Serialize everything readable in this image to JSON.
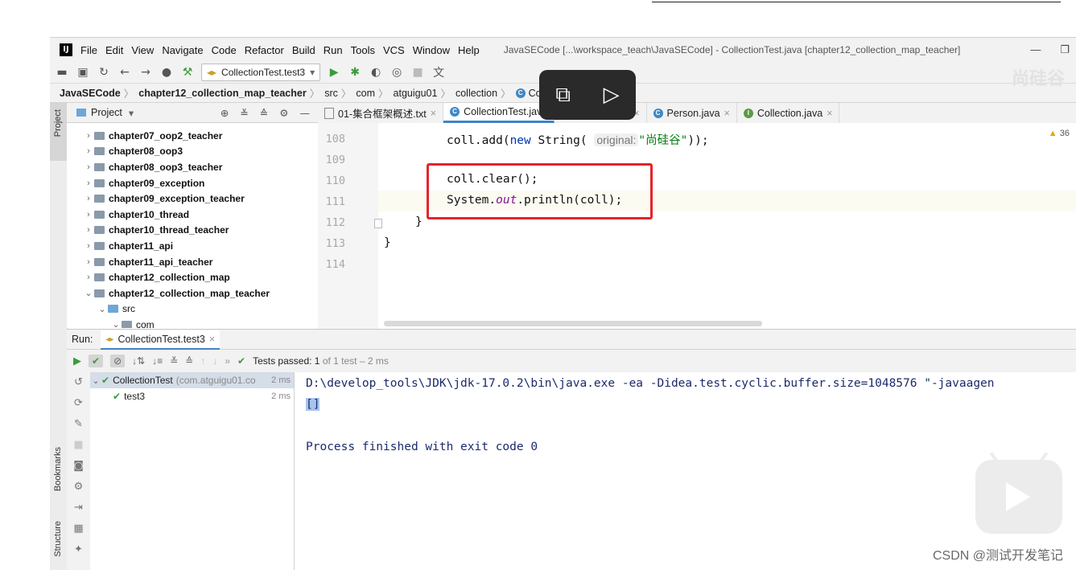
{
  "menubar": {
    "logo": "IJ",
    "items": [
      "File",
      "Edit",
      "View",
      "Navigate",
      "Code",
      "Refactor",
      "Build",
      "Run",
      "Tools",
      "VCS",
      "Window",
      "Help"
    ],
    "window_title": "JavaSECode [...\\workspace_teach\\JavaSECode] - CollectionTest.java [chapter12_collection_map_teacher]",
    "minimize": "—",
    "maximize": "❐"
  },
  "toolbar": {
    "run_config": "CollectionTest.test3"
  },
  "breadcrumb": [
    "JavaSECode",
    "chapter12_collection_map_teacher",
    "src",
    "com",
    "atguigu01",
    "collection",
    "CollectionT"
  ],
  "project_panel": {
    "title": "Project",
    "stripe_label": "Project",
    "items": [
      {
        "label": "chapter07_oop2_teacher",
        "indent": 1,
        "expanded": false,
        "type": "module"
      },
      {
        "label": "chapter08_oop3",
        "indent": 1,
        "expanded": false,
        "type": "module"
      },
      {
        "label": "chapter08_oop3_teacher",
        "indent": 1,
        "expanded": false,
        "type": "module"
      },
      {
        "label": "chapter09_exception",
        "indent": 1,
        "expanded": false,
        "type": "module"
      },
      {
        "label": "chapter09_exception_teacher",
        "indent": 1,
        "expanded": false,
        "type": "module"
      },
      {
        "label": "chapter10_thread",
        "indent": 1,
        "expanded": false,
        "type": "module"
      },
      {
        "label": "chapter10_thread_teacher",
        "indent": 1,
        "expanded": false,
        "type": "module"
      },
      {
        "label": "chapter11_api",
        "indent": 1,
        "expanded": false,
        "type": "module"
      },
      {
        "label": "chapter11_api_teacher",
        "indent": 1,
        "expanded": false,
        "type": "module"
      },
      {
        "label": "chapter12_collection_map",
        "indent": 1,
        "expanded": false,
        "type": "module"
      },
      {
        "label": "chapter12_collection_map_teacher",
        "indent": 1,
        "expanded": true,
        "type": "module"
      },
      {
        "label": "src",
        "indent": 2,
        "expanded": true,
        "type": "source"
      },
      {
        "label": "com",
        "indent": 3,
        "expanded": true,
        "type": "package"
      }
    ]
  },
  "editor_tabs": [
    {
      "label": "01-集合框架概述.txt",
      "icon": "text-file-icon",
      "active": false
    },
    {
      "label": "CollectionTest.java",
      "icon": "class-icon",
      "active": true
    },
    {
      "label": "java",
      "icon": "class-icon",
      "active": false
    },
    {
      "label": "Person.java",
      "icon": "class-icon",
      "active": false
    },
    {
      "label": "Collection.java",
      "icon": "interface-icon",
      "active": false
    }
  ],
  "editor": {
    "line_numbers": [
      "108",
      "109",
      "110",
      "111",
      "112",
      "113",
      "114"
    ],
    "line108_pre": "coll.add(",
    "line108_kw": "new",
    "line108_type": " String(",
    "line108_hint": "original:",
    "line108_str": "\"尚硅谷\"",
    "line108_end": "));",
    "line110": "coll.clear();",
    "line111_pre": "System.",
    "line111_static": "out",
    "line111_end": ".println(coll);",
    "line112": "}",
    "line113": "}",
    "warning_count": "36"
  },
  "video_overlay": {
    "watermark": "尚硅谷"
  },
  "run_panel": {
    "label": "Run:",
    "tab": "CollectionTest.test3",
    "status_bold": "Tests passed: 1",
    "status_rest": "of 1 test – 2 ms",
    "tests": [
      {
        "name": "CollectionTest",
        "detail": "(com.atguigu01.co",
        "duration": "2 ms"
      },
      {
        "name": "test3",
        "detail": "",
        "duration": "2 ms"
      }
    ],
    "console_lines": [
      "D:\\develop_tools\\JDK\\jdk-17.0.2\\bin\\java.exe -ea -Didea.test.cyclic.buffer.size=1048576 \"-javaagen",
      "[]",
      "",
      "Process finished with exit code 0"
    ],
    "side_labels": {
      "bookmarks": "Bookmarks",
      "structure": "Structure"
    }
  },
  "footer_watermark": "CSDN @测试开发笔记",
  "colors": {
    "highlight_box": "#e6232a",
    "accent": "#4083c9"
  }
}
